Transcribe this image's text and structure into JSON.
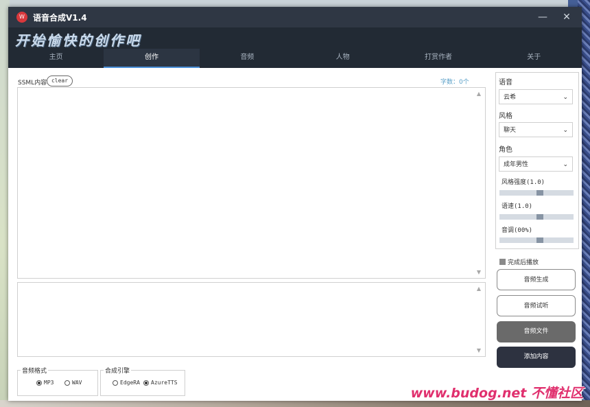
{
  "window": {
    "title": "语音合成V1.4",
    "logo_text": "W",
    "minimize_glyph": "—",
    "close_glyph": "✕"
  },
  "banner": {
    "text": "开始愉快的创作吧"
  },
  "nav": {
    "tabs": [
      {
        "label": "主页",
        "active": false
      },
      {
        "label": "创作",
        "active": true
      },
      {
        "label": "音频",
        "active": false
      },
      {
        "label": "人物",
        "active": false
      },
      {
        "label": "打赏作者",
        "active": false
      },
      {
        "label": "关于",
        "active": false
      }
    ]
  },
  "editor": {
    "ssml_label": "SSML内容",
    "clear_label": "clear",
    "char_count": "字数：0个",
    "scroll_up": "▲",
    "scroll_down": "▼"
  },
  "format_group": {
    "title": "音频格式",
    "options": [
      {
        "label": "MP3",
        "selected": true
      },
      {
        "label": "WAV",
        "selected": false
      }
    ]
  },
  "engine_group": {
    "title": "合成引擎",
    "options": [
      {
        "label": "EdgeRA",
        "selected": false
      },
      {
        "label": "AzureTTS",
        "selected": true
      }
    ]
  },
  "settings": {
    "voice_label": "语音",
    "voice_value": "云希",
    "style_label": "风格",
    "style_value": "聊天",
    "role_label": "角色",
    "role_value": "成年男性",
    "chevron": "⌄",
    "style_strength_label": "风格强度(1.0)",
    "style_strength": 0.55,
    "rate_label": "语速(1.0)",
    "rate": 0.55,
    "pitch_label": "音调(00%)",
    "pitch": 0.55
  },
  "play_after": {
    "label": "完成后播放"
  },
  "buttons": {
    "generate": "音频生成",
    "preview": "音频试听",
    "file": "音频文件",
    "add_content": "添加内容"
  },
  "watermark": {
    "text": "www.budog.net 不懂社区"
  }
}
